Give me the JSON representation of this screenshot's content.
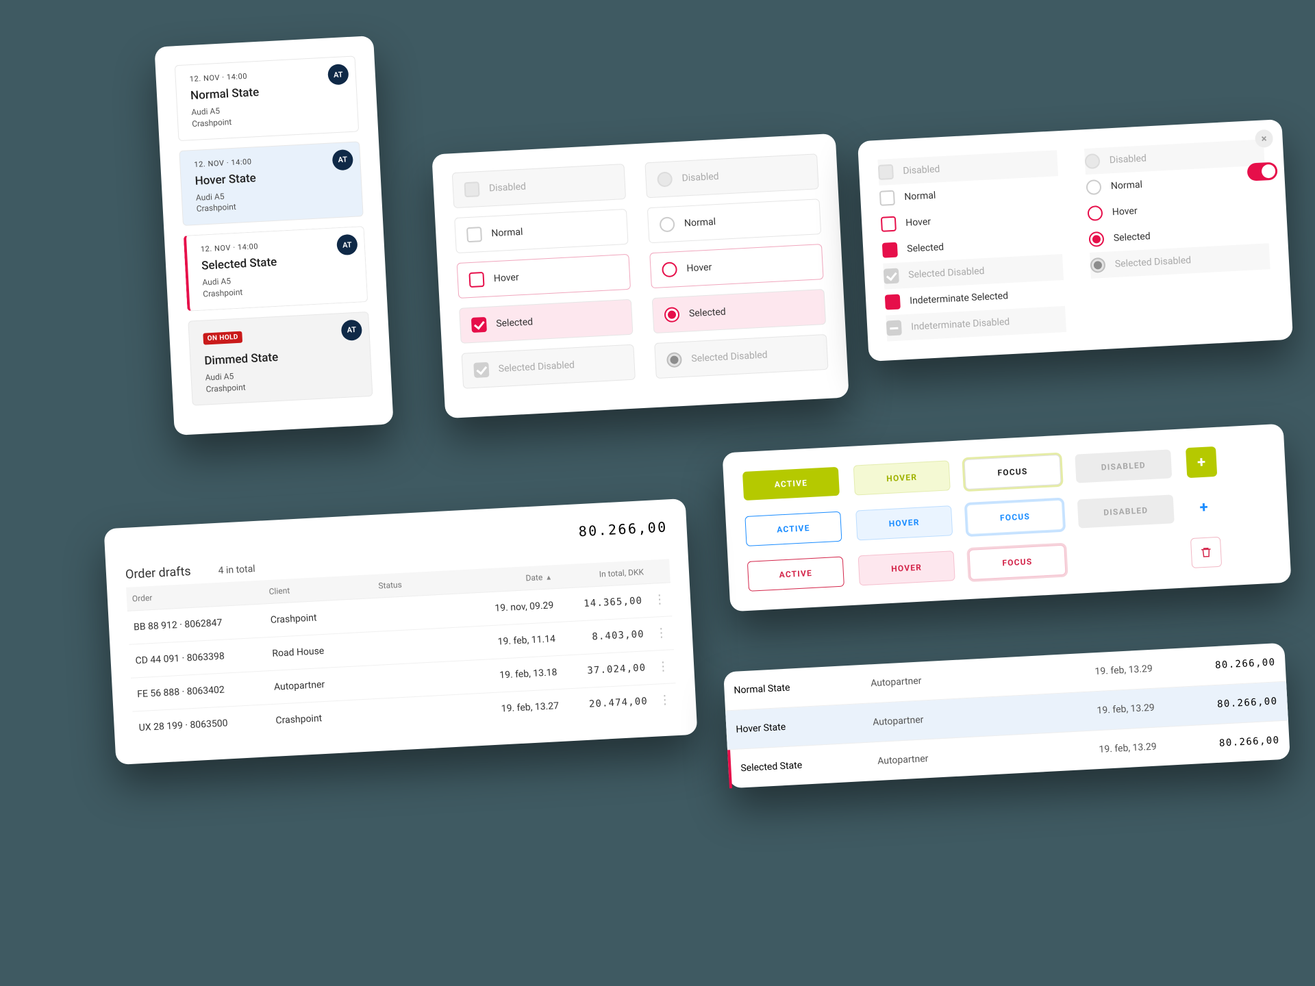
{
  "cards": {
    "avatar": "AT",
    "meta": "12. NOV · 14:00",
    "sub1": "Audi A5",
    "sub2": "Crashpoint",
    "items": [
      {
        "title": "Normal State"
      },
      {
        "title": "Hover State"
      },
      {
        "title": "Selected State"
      },
      {
        "title": "Dimmed State",
        "badge": "ON HOLD"
      }
    ]
  },
  "opts": {
    "disabled": "Disabled",
    "normal": "Normal",
    "hover": "Hover",
    "selected": "Selected",
    "selected_disabled": "Selected Disabled",
    "indeterminate_selected": "Indeterminate Selected",
    "indeterminate_disabled": "Indeterminate Disabled"
  },
  "buttons": {
    "active": "ACTIVE",
    "hover": "HOVER",
    "focus": "FOCUS",
    "disabled": "DISABLED"
  },
  "drafts": {
    "title": "Order drafts",
    "count": "4 in total",
    "sum": "80.266,00",
    "cols": {
      "order": "Order",
      "client": "Client",
      "status": "Status",
      "date": "Date",
      "total": "In total, DKK"
    },
    "rows": [
      {
        "order": "BB 88 912 · 8062847",
        "client": "Crashpoint",
        "date": "19. nov, 09.29",
        "total": "14.365,00"
      },
      {
        "order": "CD 44 091 · 8063398",
        "client": "Road House",
        "date": "19. feb, 11.14",
        "total": "8.403,00"
      },
      {
        "order": "FE 56 888 · 8063402",
        "client": "Autopartner",
        "date": "19. feb, 13.18",
        "total": "37.024,00"
      },
      {
        "order": "UX 28 199 · 8063500",
        "client": "Crashpoint",
        "date": "19. feb, 13.27",
        "total": "20.474,00"
      }
    ]
  },
  "rows2": {
    "partner": "Autopartner",
    "date": "19. feb, 13.29",
    "amt": "80.266,00",
    "items": [
      {
        "name": "Normal State"
      },
      {
        "name": "Hover State"
      },
      {
        "name": "Selected State"
      }
    ]
  }
}
